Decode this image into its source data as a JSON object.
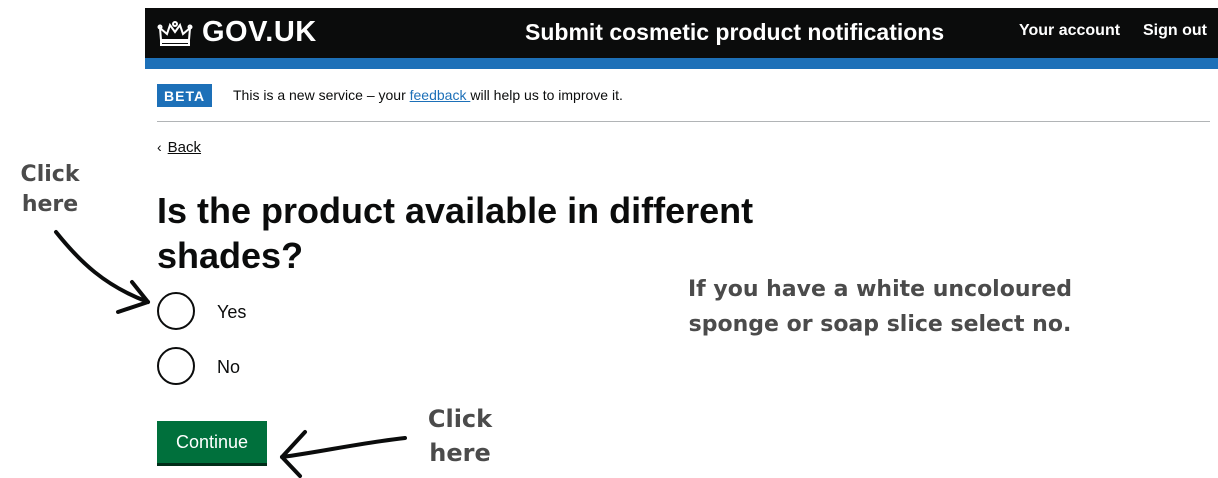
{
  "header": {
    "logo_text": "GOV.UK",
    "service_name": "Submit cosmetic product notifications",
    "nav": [
      "Your account",
      "Sign out"
    ],
    "colors": {
      "header_bg": "#0b0c0c",
      "accent_bar": "#1d70b8"
    }
  },
  "phase_banner": {
    "tag": "BETA",
    "text_before": "This is a new service – your ",
    "link": "feedback ",
    "text_after": "will help us to improve it."
  },
  "back_link": "Back",
  "question": "Is the product available in different shades?",
  "options": [
    "Yes",
    "No"
  ],
  "continue_label": "Continue",
  "annotations": {
    "radio_hint": "Click here",
    "button_hint": "Click here",
    "note": "If you have a white uncoloured sponge or soap slice select no."
  },
  "icons": [
    "crown-icon",
    "back-chevron-icon",
    "arrow-icon"
  ],
  "colors": {
    "button": "#00703c",
    "link": "#1d70b8",
    "annotation_text": "#4b4b4b"
  }
}
